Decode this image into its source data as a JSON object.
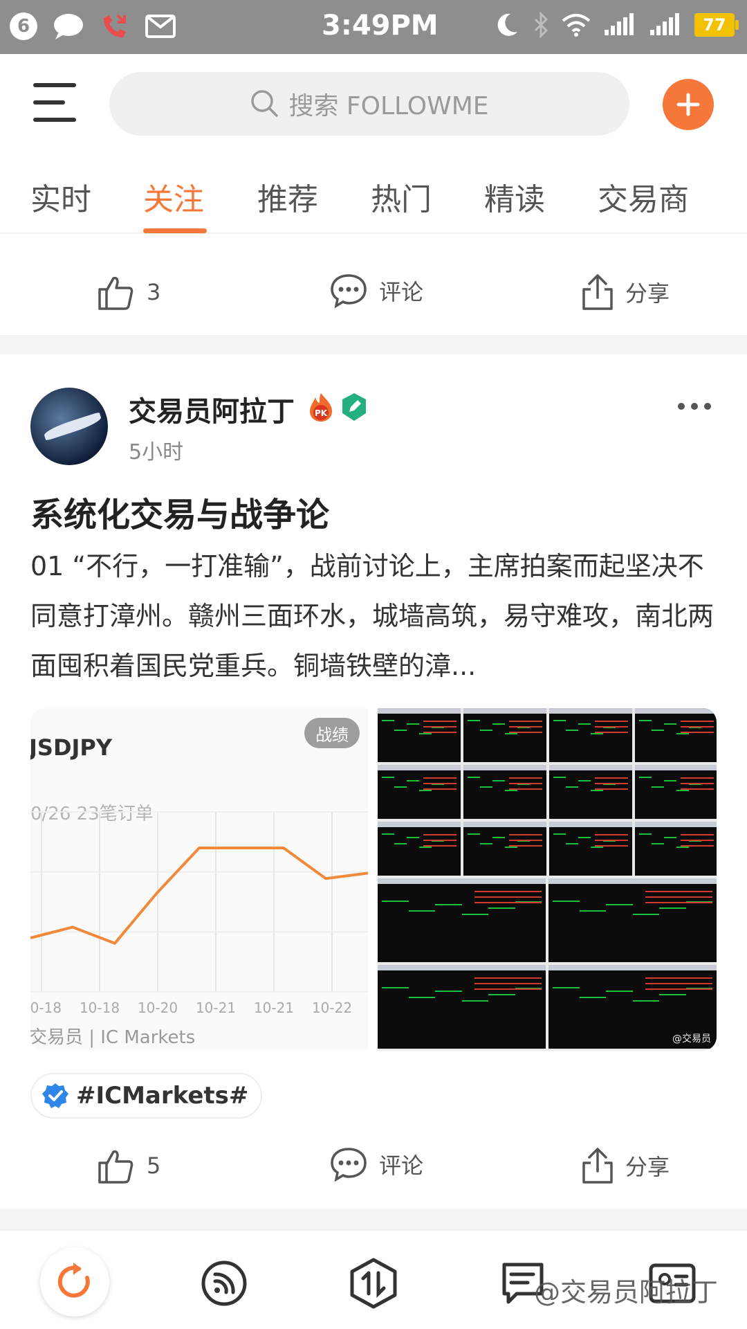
{
  "status_bar": {
    "notification_count": "6",
    "time": "3:49PM",
    "battery": "77"
  },
  "search": {
    "placeholder": "搜索 FOLLOWME"
  },
  "tabs": [
    {
      "label": "实时"
    },
    {
      "label": "关注"
    },
    {
      "label": "推荐"
    },
    {
      "label": "热门"
    },
    {
      "label": "精读"
    },
    {
      "label": "交易商"
    }
  ],
  "active_tab": "关注",
  "prev_post_actions": {
    "likes": "3",
    "comment_label": "评论",
    "share_label": "分享"
  },
  "post": {
    "author": "交易员阿拉丁",
    "time_ago": "5小时",
    "title": "系统化交易与战争论",
    "body": "01 “不行，一打准输”，战前讨论上，主席拍案而起坚决不同意打漳州。赣州三面环水，城墙高筑，易守难攻，南北两面囤积着国民党重兵。铜墙铁壁的漳...",
    "image_left": {
      "tag": "战绩",
      "symbol": "JSDJPY",
      "subtitle": "0/26 23笔订单",
      "footer": "交易员 | IC Markets"
    },
    "hashtag": "#ICMarkets#",
    "likes": "5",
    "comment_label": "评论",
    "share_label": "分享",
    "image_right_watermark": "@交易员"
  },
  "chart_data": {
    "type": "line",
    "categories": [
      "10-18",
      "10-18",
      "10-20",
      "10-21",
      "10-21",
      "10-22"
    ],
    "values": [
      0.3,
      0.36,
      0.27,
      0.55,
      0.8,
      0.8,
      0.8,
      0.63,
      0.66
    ],
    "title": "JSDJPY",
    "color": "#f08a3a"
  },
  "watermark": "@交易员阿拉丁",
  "colors": {
    "accent": "#f5783a",
    "status_bar": "#8e8e8e"
  }
}
